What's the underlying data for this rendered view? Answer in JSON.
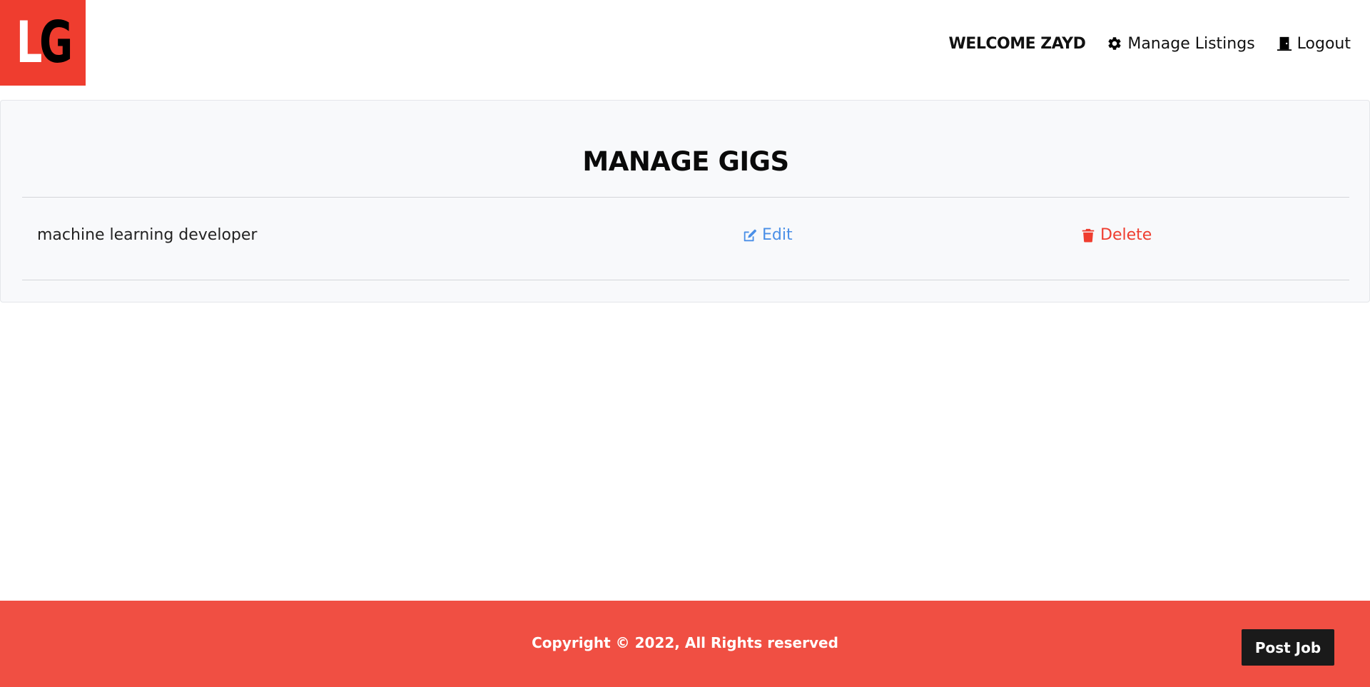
{
  "header": {
    "logo": {
      "letter_1": "L",
      "letter_2": "G",
      "color": "#ef3d2f"
    },
    "welcome": "WELCOME ZAYD",
    "nav": {
      "manage_listings": {
        "label": "Manage Listings",
        "icon": "gear-icon"
      },
      "logout": {
        "label": "Logout",
        "icon": "door-icon"
      }
    }
  },
  "main": {
    "title": "MANAGE GIGS",
    "gigs": [
      {
        "title": "machine learning developer",
        "edit_label": "Edit",
        "delete_label": "Delete"
      }
    ],
    "colors": {
      "edit": "#4a8fe7",
      "delete": "#ef3d2f",
      "panel_bg": "#f8f9fb"
    }
  },
  "footer": {
    "copyright": "Copyright © 2022, All Rights reserved",
    "post_job_label": "Post Job",
    "background": "#f04f43"
  }
}
